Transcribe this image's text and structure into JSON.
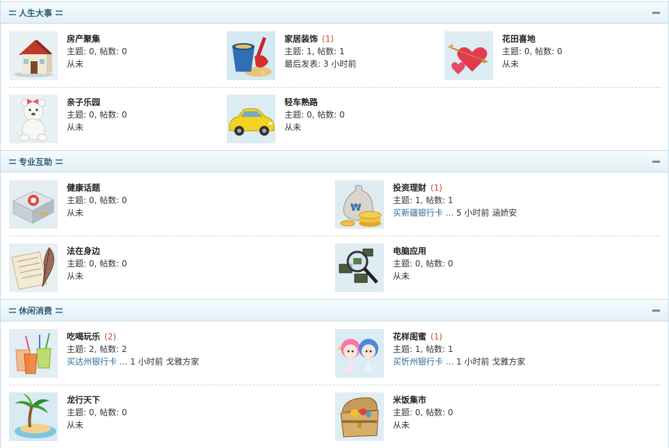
{
  "categories": [
    {
      "title": "人生大事",
      "forums": [
        {
          "name": "房产聚集",
          "today": "",
          "stats": "主题: 0, 帖数: 0",
          "last_prefix": "从未",
          "last_link": "",
          "last_suffix": "",
          "icon": "house-icon"
        },
        {
          "name": "家居装饰",
          "today": "(1)",
          "stats": "主题: 1, 帖数: 1",
          "last_prefix": "最后发表: 3 小时前",
          "last_link": "",
          "last_suffix": "",
          "icon": "sand-bucket-icon"
        },
        {
          "name": "花田喜地",
          "today": "",
          "stats": "主题: 0, 帖数: 0",
          "last_prefix": "从未",
          "last_link": "",
          "last_suffix": "",
          "icon": "hearts-arrow-icon"
        },
        {
          "name": "亲子乐园",
          "today": "",
          "stats": "主题: 0, 帖数: 0",
          "last_prefix": "从未",
          "last_link": "",
          "last_suffix": "",
          "icon": "teddy-bear-icon"
        },
        {
          "name": "轻车熟路",
          "today": "",
          "stats": "主题: 0, 帖数: 0",
          "last_prefix": "从未",
          "last_link": "",
          "last_suffix": "",
          "icon": "car-icon"
        }
      ]
    },
    {
      "title": "专业互助",
      "forums": [
        {
          "name": "健康话题",
          "today": "",
          "stats": "主题: 0, 帖数: 0",
          "last_prefix": "从未",
          "last_link": "",
          "last_suffix": "",
          "icon": "first-aid-kit-icon"
        },
        {
          "name": "投资理财",
          "today": "(1)",
          "stats": "主题: 1, 帖数: 1",
          "last_prefix": "",
          "last_link": "买新疆银行卡 ...",
          "last_suffix": " 5 小时前 涵娇安",
          "icon": "money-bag-icon"
        },
        {
          "name": "法在身边",
          "today": "",
          "stats": "主题: 0, 帖数: 0",
          "last_prefix": "从未",
          "last_link": "",
          "last_suffix": "",
          "icon": "quill-paper-icon"
        },
        {
          "name": "电脑应用",
          "today": "",
          "stats": "主题: 0, 帖数: 0",
          "last_prefix": "从未",
          "last_link": "",
          "last_suffix": "",
          "icon": "magnifier-chips-icon"
        }
      ]
    },
    {
      "title": "休闲消费",
      "forums": [
        {
          "name": "吃喝玩乐",
          "today": "(2)",
          "stats": "主题: 2, 帖数: 2",
          "last_prefix": "",
          "last_link": "买达州银行卡 ...",
          "last_suffix": " 1 小时前 戈雅方家",
          "icon": "drinks-icon"
        },
        {
          "name": "花样闺蜜",
          "today": "(1)",
          "stats": "主题: 1, 帖数: 1",
          "last_prefix": "",
          "last_link": "买忻州银行卡 ...",
          "last_suffix": " 1 小时前 戈雅方家",
          "icon": "twin-stars-icon"
        },
        {
          "name": "龙行天下",
          "today": "",
          "stats": "主题: 0, 帖数: 0",
          "last_prefix": "从未",
          "last_link": "",
          "last_suffix": "",
          "icon": "palm-island-icon"
        },
        {
          "name": "米饭集市",
          "today": "",
          "stats": "主题: 0, 帖数: 0",
          "last_prefix": "从未",
          "last_link": "",
          "last_suffix": "",
          "icon": "treasure-chest-icon"
        }
      ]
    }
  ],
  "colors": {
    "link": "#2a6a95",
    "today": "#d0442b",
    "header": "#2b5c7a"
  }
}
